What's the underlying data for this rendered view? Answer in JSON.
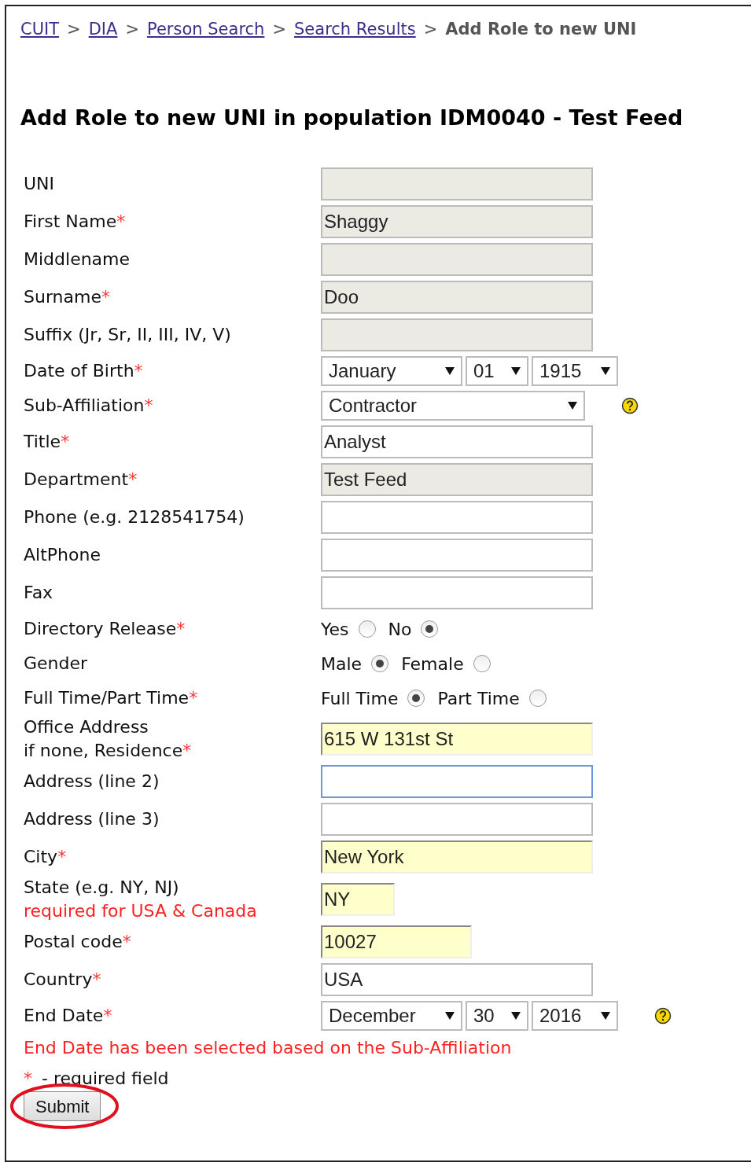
{
  "breadcrumb": {
    "links": [
      "CUIT",
      "DIA",
      "Person Search",
      "Search Results"
    ],
    "separator": ">",
    "current": "Add Role to new UNI"
  },
  "heading": "Add Role to new UNI in population IDM0040 - Test Feed",
  "required_mark": "*",
  "rows": [
    {
      "kind": "text",
      "label": "UNI",
      "required": false,
      "value": "",
      "disabled": true,
      "highlighted": false,
      "focused": false
    },
    {
      "kind": "text",
      "label": "First Name",
      "required": true,
      "value": "Shaggy",
      "disabled": true,
      "highlighted": false,
      "focused": false
    },
    {
      "kind": "text",
      "label": "Middlename",
      "required": false,
      "value": "",
      "disabled": true,
      "highlighted": false,
      "focused": false
    },
    {
      "kind": "text",
      "label": "Surname",
      "required": true,
      "value": "Doo",
      "disabled": true,
      "highlighted": false,
      "focused": false
    },
    {
      "kind": "text",
      "label": "Suffix (Jr, Sr, II, III, IV, V)",
      "required": false,
      "value": "",
      "disabled": true,
      "highlighted": false,
      "focused": false
    },
    {
      "kind": "select",
      "label": "Date of Birth",
      "required": true,
      "help": false,
      "selects": [
        {
          "value": "January"
        },
        {
          "value": "01"
        },
        {
          "value": "1915"
        }
      ]
    },
    {
      "kind": "select",
      "label": "Sub-Affiliation",
      "required": true,
      "help": true,
      "selects": [
        {
          "value": "Contractor"
        }
      ]
    },
    {
      "kind": "text",
      "label": "Title",
      "required": true,
      "value": "Analyst",
      "disabled": false,
      "highlighted": false,
      "focused": false
    },
    {
      "kind": "text",
      "label": "Department",
      "required": true,
      "value": "Test Feed",
      "disabled": true,
      "highlighted": false,
      "focused": false
    },
    {
      "kind": "text",
      "label": "Phone (e.g. 2128541754)",
      "required": false,
      "value": "",
      "disabled": false,
      "highlighted": false,
      "focused": false
    },
    {
      "kind": "text",
      "label": "AltPhone",
      "required": false,
      "value": "",
      "disabled": false,
      "highlighted": false,
      "focused": false
    },
    {
      "kind": "text",
      "label": "Fax",
      "required": false,
      "value": "",
      "disabled": false,
      "highlighted": false,
      "focused": false
    },
    {
      "kind": "radio",
      "label": "Directory Release",
      "required": true,
      "options": [
        {
          "label": "Yes",
          "selected": false
        },
        {
          "label": "No",
          "selected": true
        }
      ]
    },
    {
      "kind": "radio",
      "label": "Gender",
      "required": false,
      "options": [
        {
          "label": "Male",
          "selected": true
        },
        {
          "label": "Female",
          "selected": false
        }
      ]
    },
    {
      "kind": "radio",
      "label": "Full Time/Part Time",
      "required": true,
      "options": [
        {
          "label": "Full Time",
          "selected": true
        },
        {
          "label": "Part Time",
          "selected": false
        }
      ]
    },
    {
      "kind": "text",
      "label": "Office Address",
      "label_line2": "if none, Residence",
      "required": true,
      "value": "615 W 131st St",
      "disabled": false,
      "highlighted": true,
      "focused": false
    },
    {
      "kind": "text",
      "label": "Address (line 2)",
      "required": false,
      "value": "",
      "disabled": false,
      "highlighted": false,
      "focused": true
    },
    {
      "kind": "text",
      "label": "Address (line 3)",
      "required": false,
      "value": "",
      "disabled": false,
      "highlighted": false,
      "focused": false
    },
    {
      "kind": "text",
      "label": "City",
      "required": true,
      "value": "New York",
      "disabled": false,
      "highlighted": true,
      "focused": false
    },
    {
      "kind": "text_small",
      "label": "State (e.g. NY, NJ)",
      "note": "required for USA & Canada",
      "required": false,
      "value": "NY",
      "disabled": false,
      "highlighted": true,
      "focused": false
    },
    {
      "kind": "text_medium",
      "label": "Postal code",
      "required": true,
      "value": "10027",
      "disabled": false,
      "highlighted": true,
      "focused": false
    },
    {
      "kind": "text",
      "label": "Country",
      "required": true,
      "value": "USA",
      "disabled": false,
      "highlighted": false,
      "focused": false
    },
    {
      "kind": "select",
      "label": "End Date",
      "required": true,
      "help": true,
      "selects": [
        {
          "value": "December"
        },
        {
          "value": "30"
        },
        {
          "value": "2016"
        }
      ]
    }
  ],
  "end_date_notice": "End Date has been selected based on the Sub-Affiliation",
  "required_legend": "- required field",
  "submit": "Submit",
  "submit_circled": true
}
